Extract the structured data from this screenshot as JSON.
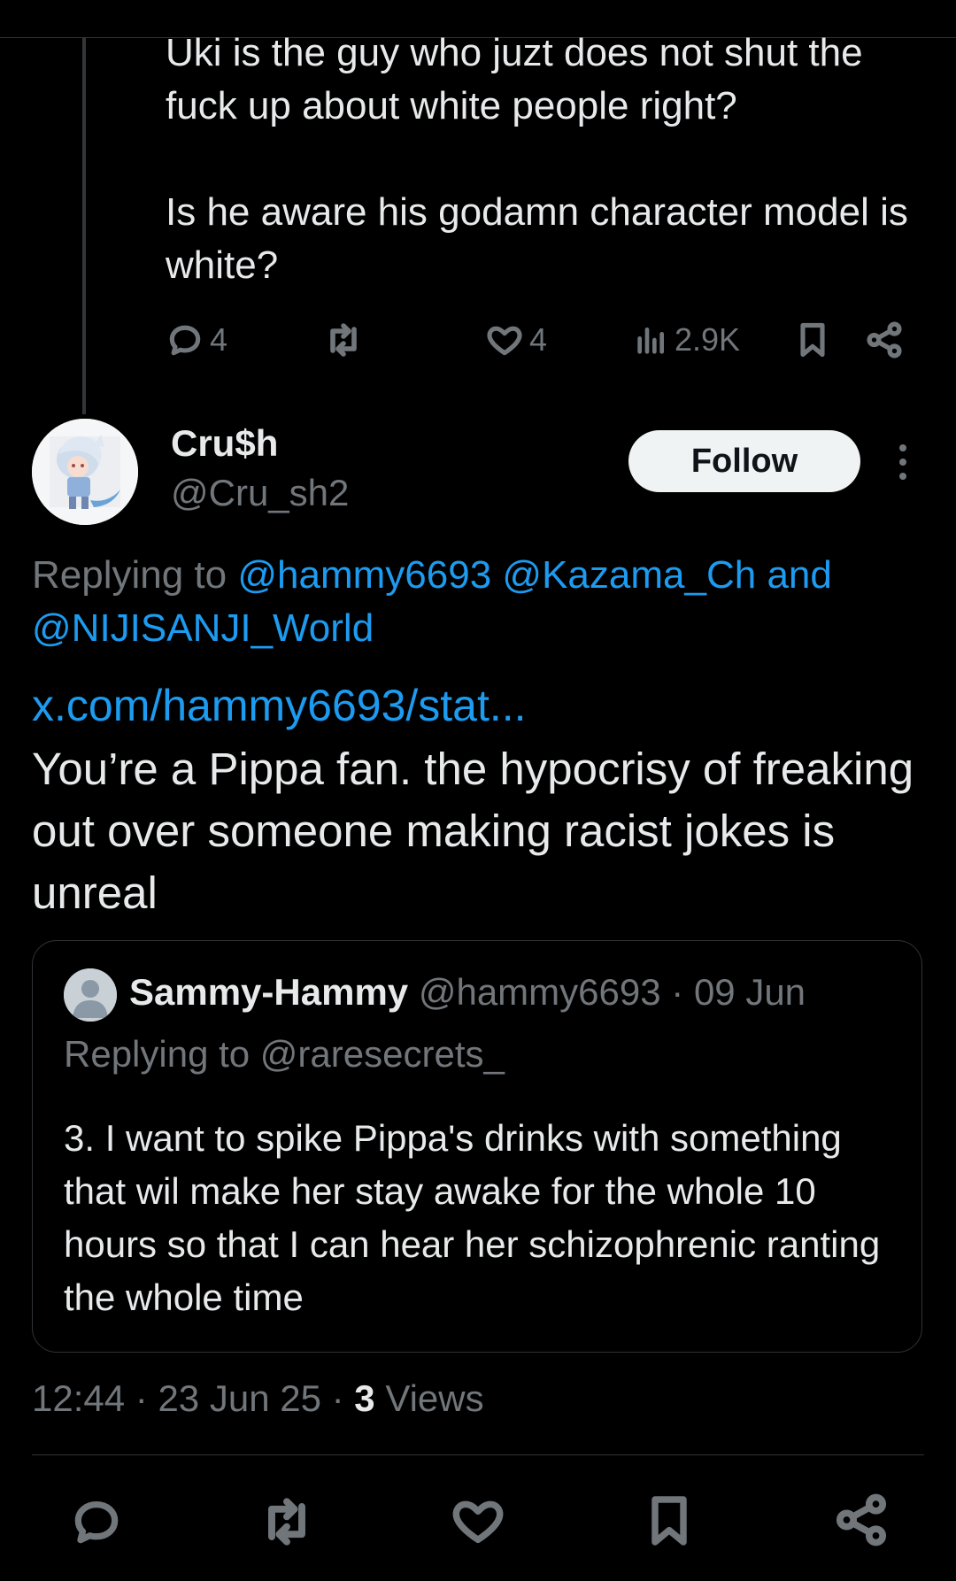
{
  "parent_tweet": {
    "paragraphs": [
      "Uki is the guy who juzt does not shut the fuck up about white people right?",
      "Is he aware his godamn character model is white?"
    ],
    "replies": "4",
    "likes": "4",
    "views": "2.9K"
  },
  "tweet": {
    "display_name": "Cru$h",
    "handle": "@Cru_sh2",
    "follow_label": "Follow",
    "replying_prefix": "Replying to",
    "mention_1": "@hammy6693",
    "mention_2": "@Kazama_Ch",
    "and_word": "and",
    "mention_3": "@NIJISANJI_World",
    "link": "x.com/hammy6693/stat...",
    "text": "You’re a Pippa fan. the hypocrisy of freaking out over someone making racist jokes is unreal",
    "time": "12:44",
    "date": "23 Jun 25",
    "views_count": "3",
    "views_label": "Views"
  },
  "quote": {
    "name": "Sammy-Hammy",
    "handle": "@hammy6693",
    "date": "09 Jun",
    "separator": "·",
    "replying": "Replying to @raresecrets_",
    "text": "3. I want to spike Pippa's drinks with something that wil make her stay awake for the whole 10 hours so that I can hear her schizophrenic ranting the whole time"
  },
  "colors": {
    "background": "#000000",
    "text": "#e7e9ea",
    "muted": "#71767b",
    "accent": "#1d9bf0",
    "border": "#2f3336"
  },
  "icons": {
    "reply": "reply-icon",
    "repost": "repost-icon",
    "like": "heart-icon",
    "views": "views-icon",
    "bookmark": "bookmark-icon",
    "share": "share-icon",
    "more": "more-vertical-icon"
  }
}
